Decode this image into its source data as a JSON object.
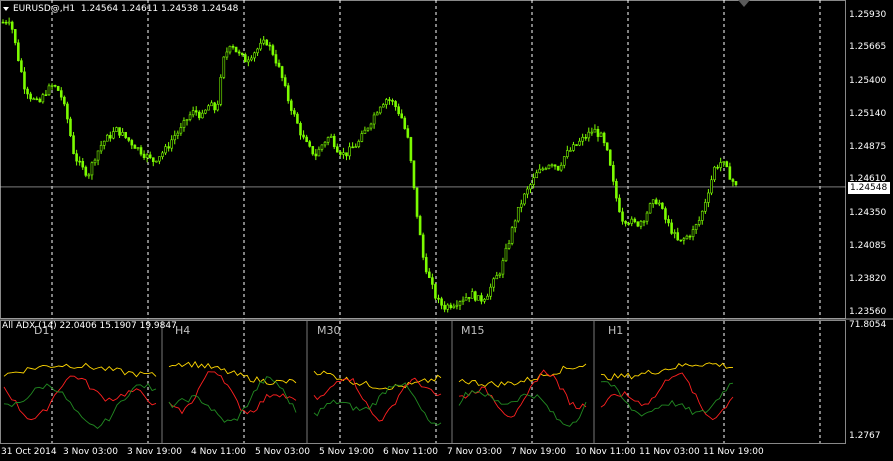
{
  "header": {
    "symbol": "EURUSD@,H1",
    "ohlc": "1.24564 1.24611 1.24538 1.24548"
  },
  "price_axis": {
    "ticks": [
      "1.25930",
      "1.25665",
      "1.25400",
      "1.25140",
      "1.24875",
      "1.24610",
      "1.24350",
      "1.24085",
      "1.23820",
      "1.23560"
    ],
    "current_price": "1.24548"
  },
  "indicator": {
    "label": "All ADX (14) 22.0406 15.1907 19.9847",
    "max": "71.8054",
    "min": "1.2767",
    "timeframes": [
      "D1",
      "H4",
      "M30",
      "M15",
      "H1"
    ]
  },
  "time_axis": [
    "31 Oct 2014",
    "3 Nov 03:00",
    "3 Nov 19:00",
    "4 Nov 11:00",
    "5 Nov 03:00",
    "5 Nov 19:00",
    "6 Nov 11:00",
    "7 Nov 03:00",
    "7 Nov 19:00",
    "10 Nov 11:00",
    "11 Nov 03:00",
    "11 Nov 19:00"
  ],
  "colors": {
    "candle": "#7CFC00",
    "adx_main": "#ffd700",
    "adx_plus": "#228b22",
    "adx_minus": "#ff2020",
    "grid": "#ffffff"
  },
  "chart_data": {
    "type": "candlestick",
    "title": "EURUSD@,H1",
    "ylim": [
      1.2356,
      1.26
    ],
    "close_profile": [
      1.2585,
      1.2588,
      1.256,
      1.2535,
      1.2525,
      1.252,
      1.253,
      1.2535,
      1.253,
      1.251,
      1.248,
      1.247,
      1.2465,
      1.248,
      1.249,
      1.2495,
      1.25,
      1.2495,
      1.249,
      1.2485,
      1.248,
      1.2475,
      1.248,
      1.2485,
      1.2495,
      1.25,
      1.251,
      1.2515,
      1.251,
      1.252,
      1.2515,
      1.2555,
      1.257,
      1.256,
      1.2555,
      1.256,
      1.2565,
      1.257,
      1.256,
      1.2545,
      1.2525,
      1.251,
      1.2495,
      1.2485,
      1.248,
      1.249,
      1.2495,
      1.2485,
      1.248,
      1.2485,
      1.249,
      1.25,
      1.251,
      1.252,
      1.2525,
      1.252,
      1.251,
      1.249,
      1.244,
      1.24,
      1.238,
      1.2365,
      1.236,
      1.2362,
      1.2365,
      1.2368,
      1.237,
      1.2365,
      1.237,
      1.238,
      1.239,
      1.241,
      1.243,
      1.2445,
      1.2455,
      1.2465,
      1.247,
      1.2475,
      1.247,
      1.248,
      1.2485,
      1.249,
      1.2495,
      1.25,
      1.2495,
      1.248,
      1.245,
      1.243,
      1.2428,
      1.2425,
      1.243,
      1.244,
      1.2445,
      1.243,
      1.242,
      1.241,
      1.2415,
      1.242,
      1.243,
      1.245,
      1.247,
      1.2475,
      1.2465,
      1.2455
    ]
  }
}
